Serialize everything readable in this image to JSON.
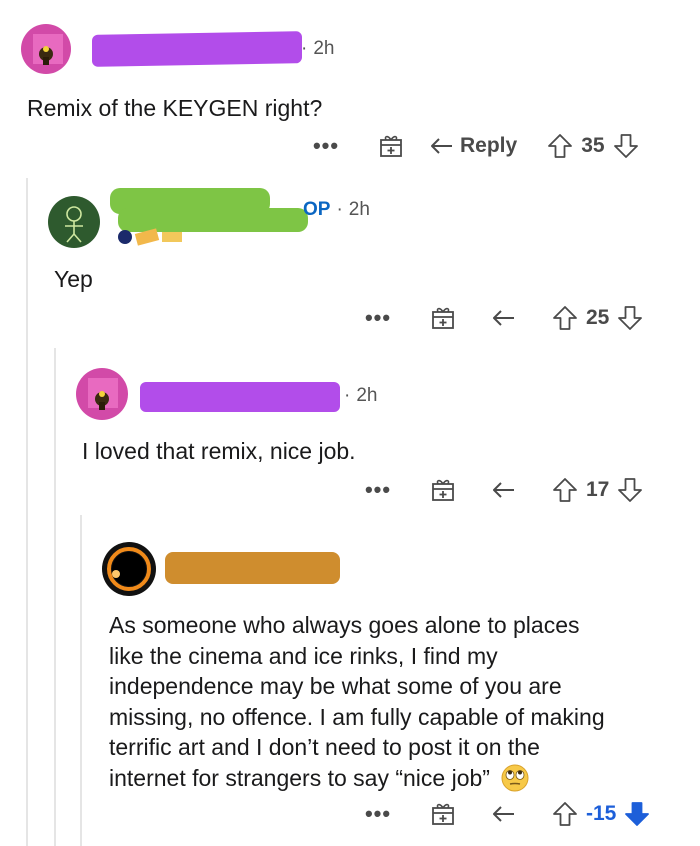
{
  "comments": [
    {
      "author_redacted": true,
      "time": "2h",
      "body": "Remix of the KEYGEN right?",
      "actions": {
        "more": "•••",
        "reply_label": "Reply",
        "votes": "35"
      },
      "colors": {
        "redaction": "#b24dea",
        "avatar_bg": "#d24aa8"
      }
    },
    {
      "author_redacted": true,
      "op_label": "OP",
      "time": "2h",
      "body": "Yep",
      "actions": {
        "more": "•••",
        "votes": "25"
      },
      "colors": {
        "redaction": "#7ec545",
        "avatar_bg": "#2e5a2e"
      }
    },
    {
      "author_redacted": true,
      "time": "2h",
      "body": "I loved that remix, nice job.",
      "actions": {
        "more": "•••",
        "votes": "17"
      },
      "colors": {
        "redaction": "#b24dea",
        "avatar_bg": "#d24aa8"
      }
    },
    {
      "author_redacted": true,
      "body_lines": [
        "As someone who always goes alone to places",
        "like the cinema and ice rinks, I find my",
        "independence may be what some of you are",
        "missing, no offence. I am fully capable of making",
        "terrific art and I don’t need to post it on the",
        "internet for strangers to say “nice job”"
      ],
      "emoji_icon": "eye-roll-emoji-icon",
      "actions": {
        "more": "•••",
        "votes": "-15"
      },
      "colors": {
        "redaction": "#cf8d2e",
        "avatar_bg": "#111111",
        "downvote_active": "#1d5fd9"
      }
    }
  ]
}
